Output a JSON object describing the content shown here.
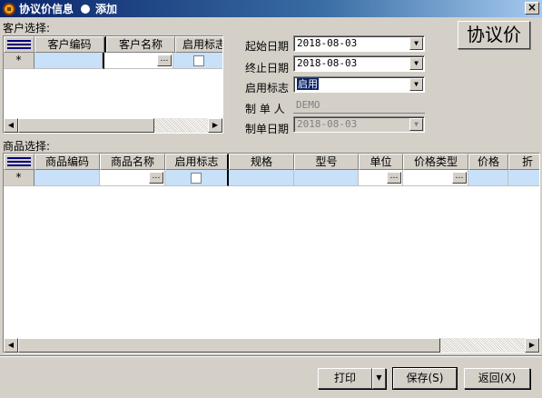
{
  "window": {
    "title": "协议价信息",
    "mode": "添加",
    "close_symbol": "×"
  },
  "customer_section": {
    "label": "客户选择:",
    "columns": [
      "客户编码",
      "客户名称",
      "启用标志"
    ],
    "new_row_marker": "*"
  },
  "product_section": {
    "label": "商品选择:",
    "columns": [
      "商品编码",
      "商品名称",
      "启用标志",
      "规格",
      "型号",
      "单位",
      "价格类型",
      "价格",
      "折"
    ],
    "new_row_marker": "*"
  },
  "form": {
    "start_date_label": "起始日期",
    "start_date_value": "2018-08-03",
    "end_date_label": "终止日期",
    "end_date_value": "2018-08-03",
    "enabled_label": "启用标志",
    "enabled_value": "启用",
    "creator_label": "制 单 人",
    "creator_value": "DEMO",
    "create_date_label": "制单日期",
    "create_date_value": "2018-08-03"
  },
  "big_label": "协议价",
  "buttons": {
    "print": "打印",
    "save": "保存(S)",
    "back": "返回(X)"
  },
  "icons": {
    "ellipsis": "…",
    "dropdown": "▼",
    "scroll_left": "◀",
    "scroll_right": "▶"
  }
}
